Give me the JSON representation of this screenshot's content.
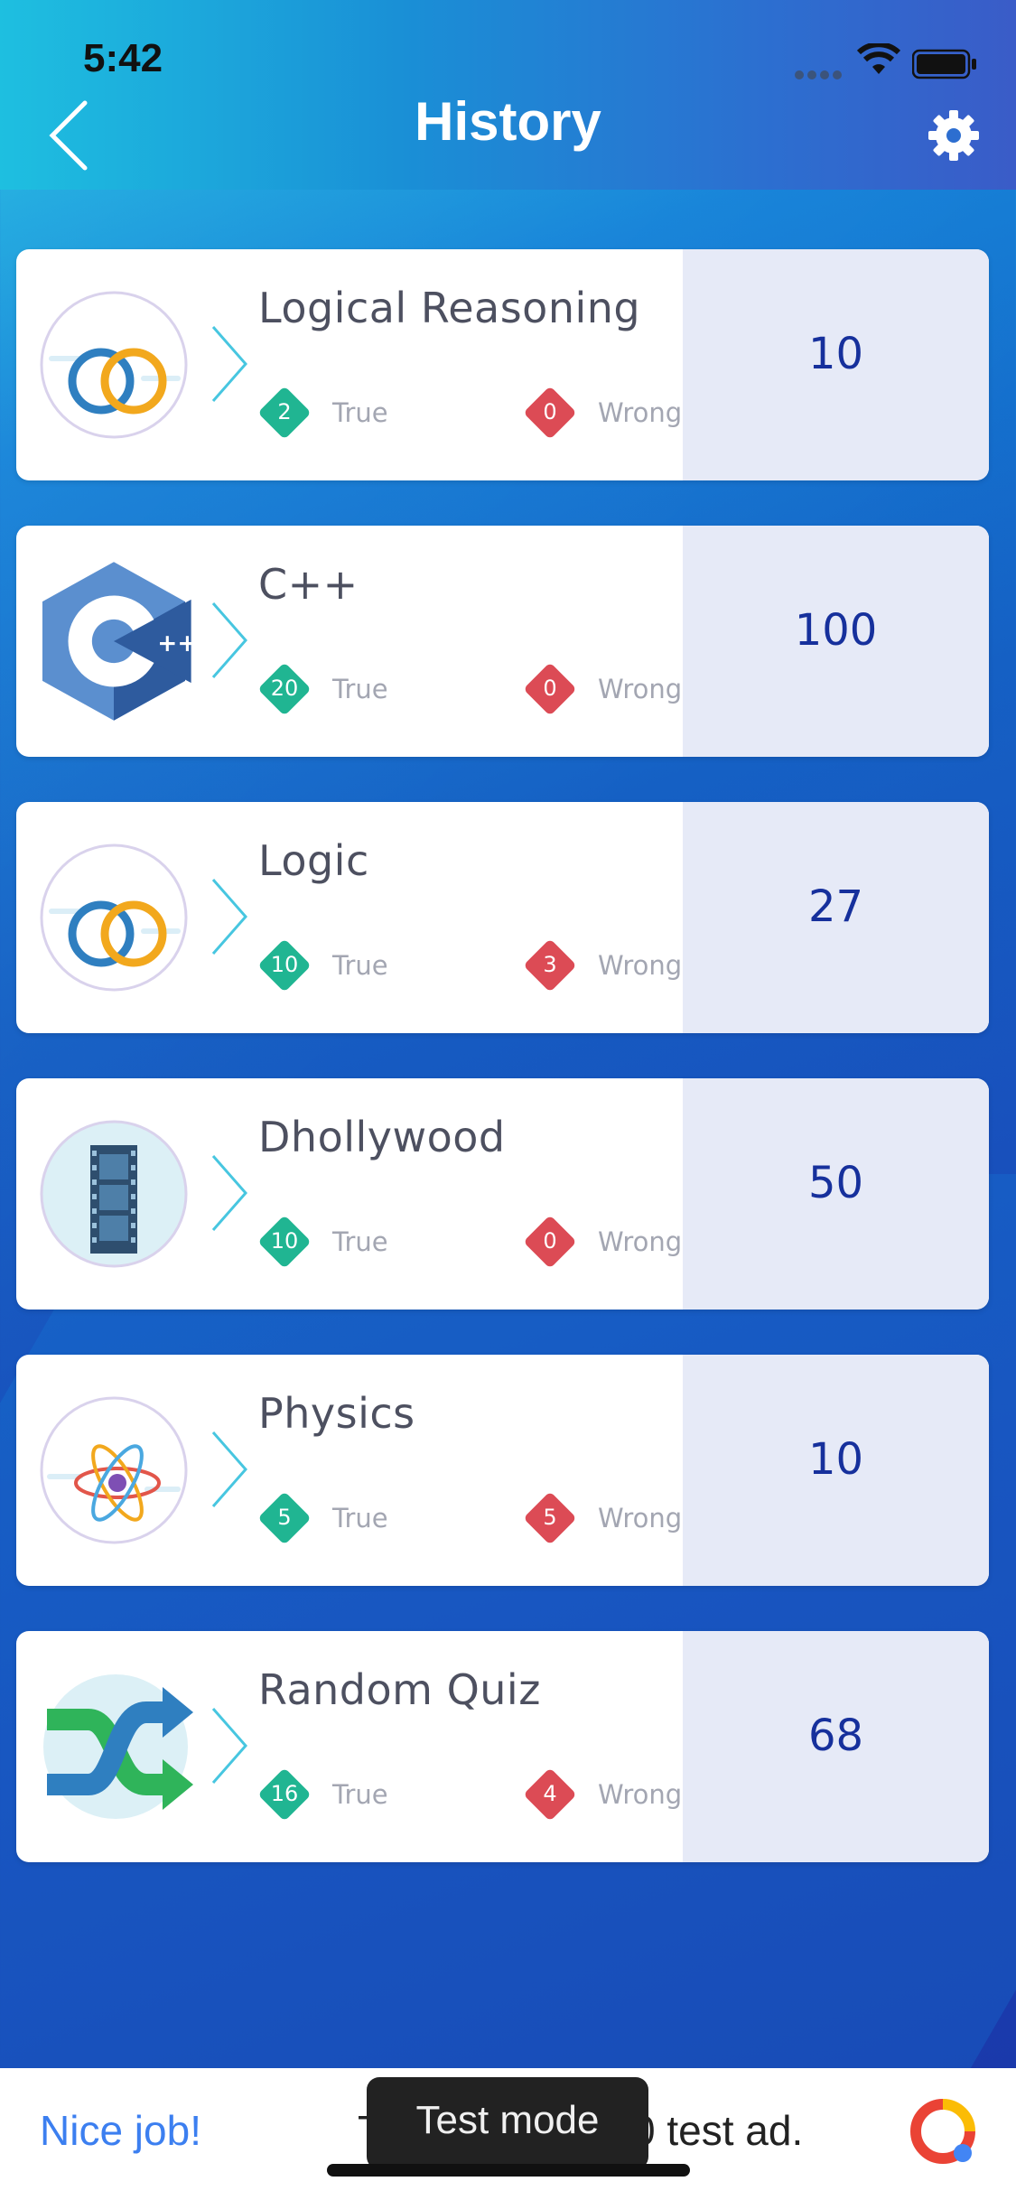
{
  "status_bar": {
    "time": "5:42"
  },
  "header": {
    "title": "History"
  },
  "labels": {
    "true": "True",
    "wrong": "Wrong"
  },
  "quizzes": [
    {
      "name": "Logical Reasoning",
      "icon": "rings-icon",
      "true_count": "2",
      "wrong_count": "0",
      "score": "10"
    },
    {
      "name": "C++",
      "icon": "cpp-logo-icon",
      "true_count": "20",
      "wrong_count": "0",
      "score": "100"
    },
    {
      "name": "Logic",
      "icon": "rings-icon",
      "true_count": "10",
      "wrong_count": "3",
      "score": "27"
    },
    {
      "name": "Dhollywood",
      "icon": "film-strip-icon",
      "true_count": "10",
      "wrong_count": "0",
      "score": "50"
    },
    {
      "name": "Physics",
      "icon": "atom-icon",
      "true_count": "5",
      "wrong_count": "5",
      "score": "10"
    },
    {
      "name": "Random Quiz",
      "icon": "shuffle-icon",
      "true_count": "16",
      "wrong_count": "4",
      "score": "68"
    }
  ],
  "ad": {
    "title": "Nice job!",
    "text_left": "T",
    "text_right": "0 test ad.",
    "badge": "Test mode"
  },
  "colors": {
    "true_badge": "#20b592",
    "wrong_badge": "#dc4b55",
    "score_text": "#16309c",
    "score_panel": "#e6eaf7"
  }
}
